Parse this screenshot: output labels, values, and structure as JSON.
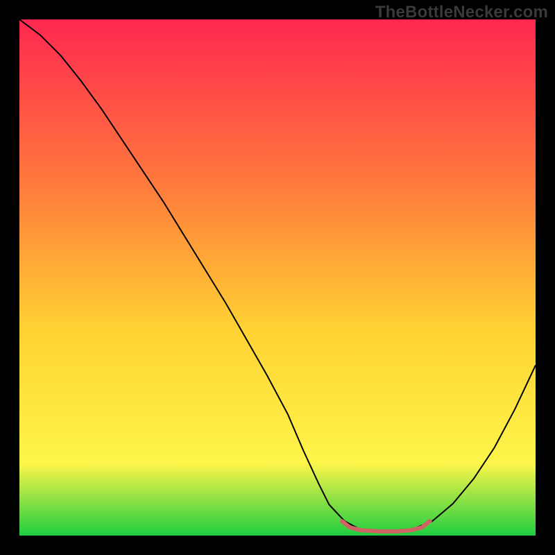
{
  "watermark": "TheBottleNecker.com",
  "chart_data": {
    "type": "line",
    "title": "",
    "xlabel": "",
    "ylabel": "",
    "xlim": [
      0,
      100
    ],
    "ylim": [
      0,
      100
    ],
    "grid": false,
    "background_gradient_top": "#ff2850",
    "background_gradient_mid_upper": "#ff7a3c",
    "background_gradient_mid": "#ffd233",
    "background_gradient_lower": "#fdf54a",
    "background_gradient_bottom": "#1fce3f",
    "series": [
      {
        "name": "bottleneck-curve",
        "color": "#000000",
        "stroke_width": 2,
        "x": [
          0,
          4,
          8,
          12,
          16,
          20,
          24,
          28,
          32,
          36,
          40,
          44,
          48,
          52,
          55,
          58,
          60,
          63,
          66,
          70,
          73,
          76,
          80,
          84,
          88,
          92,
          96,
          100
        ],
        "values": [
          100,
          97,
          93,
          88,
          82.5,
          76.5,
          70.5,
          64.5,
          58,
          51.5,
          45,
          38,
          31,
          23.5,
          16.5,
          10,
          6,
          2.8,
          1.2,
          0.8,
          0.8,
          1.2,
          2.8,
          6.2,
          11,
          17,
          24.5,
          33
        ]
      },
      {
        "name": "optimal-range-marker",
        "color": "#d06464",
        "stroke_width": 6,
        "x": [
          62.5,
          64,
          66,
          70,
          73,
          76,
          78,
          79.5
        ],
        "values": [
          2.8,
          1.6,
          1.05,
          0.8,
          0.8,
          1.05,
          1.6,
          2.8
        ]
      }
    ]
  }
}
